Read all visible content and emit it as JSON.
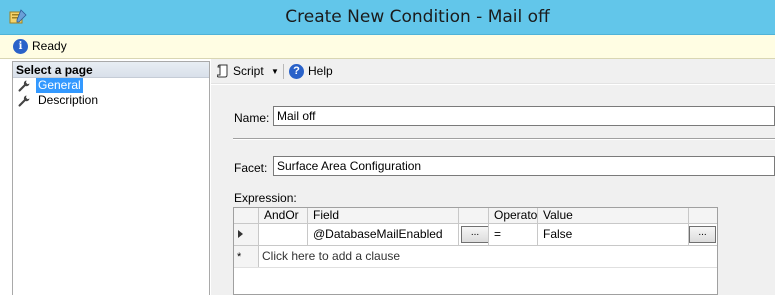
{
  "window": {
    "title": "Create New Condition - Mail off",
    "icon": "policy-wizard-icon"
  },
  "status": {
    "icon": "info-icon",
    "text": "Ready"
  },
  "left_pane": {
    "header": "Select a page",
    "pages": [
      {
        "label": "General",
        "icon": "wrench-icon",
        "selected": true
      },
      {
        "label": "Description",
        "icon": "wrench-icon",
        "selected": false
      }
    ]
  },
  "toolbar": {
    "script_label": "Script",
    "dropdown_glyph": "▼",
    "help_label": "Help"
  },
  "form": {
    "name_label": "Name:",
    "name_value": "Mail off",
    "facet_label": "Facet:",
    "facet_value": "Surface Area Configuration",
    "expression_label": "Expression:"
  },
  "grid": {
    "columns": [
      "AndOr",
      "Field",
      "",
      "Operator",
      "Value",
      ""
    ],
    "rows": [
      {
        "andor": "",
        "field": "@DatabaseMailEnabled",
        "field_button": "...",
        "operator": "=",
        "value": "False",
        "value_button": "..."
      }
    ],
    "add_clause_text": "Click here to add a clause",
    "new_row_glyph": "*"
  },
  "colors": {
    "titlebar": "#62c6ea",
    "statusbar": "#fffde3",
    "selection": "#3399ff"
  }
}
